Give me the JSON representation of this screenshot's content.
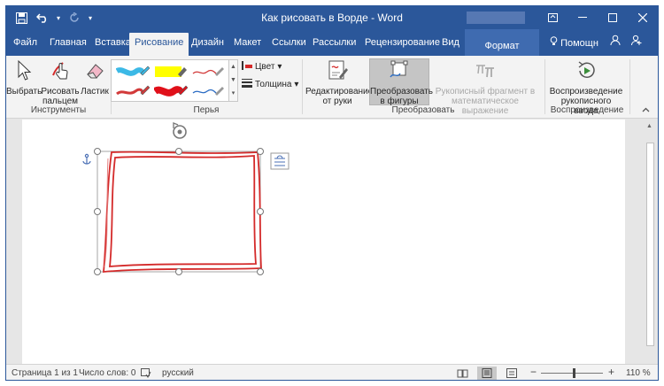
{
  "window": {
    "title": "Как рисовать в Ворде  -  Word",
    "controls": [
      "restore-ribbon",
      "minimize",
      "maximize",
      "close"
    ]
  },
  "quick_access": {
    "save_icon": "save-icon",
    "undo_icon": "undo-icon",
    "redo_icon": "redo-icon"
  },
  "tabs": [
    {
      "label": "Файл"
    },
    {
      "label": "Главная"
    },
    {
      "label": "Вставка"
    },
    {
      "label": "Рисование",
      "active": true
    },
    {
      "label": "Дизайн"
    },
    {
      "label": "Макет"
    },
    {
      "label": "Ссылки"
    },
    {
      "label": "Рассылки"
    },
    {
      "label": "Рецензирование"
    },
    {
      "label": "Вид"
    },
    {
      "label": "Формат",
      "contextual": true
    }
  ],
  "help": {
    "label": "Помощн"
  },
  "ribbon": {
    "tools": {
      "group_label": "Инструменты",
      "select_label": "Выбрать",
      "finger_label_1": "Рисовать",
      "finger_label_2": "пальцем",
      "eraser_label": "Ластик"
    },
    "pens": {
      "group_label": "Перья",
      "color_label": "Цвет",
      "thickness_label": "Толщина",
      "items": [
        {
          "type": "marker",
          "color": "#3cb9e6"
        },
        {
          "type": "highlighter",
          "color": "#ffff00"
        },
        {
          "type": "pen",
          "color": "#d23a3a"
        },
        {
          "type": "pen",
          "color": "#d23a3a"
        },
        {
          "type": "marker",
          "color": "#e0101a"
        },
        {
          "type": "pen",
          "color": "#2b6cc4"
        }
      ]
    },
    "convert": {
      "group_label": "Преобразовать",
      "edit_label_1": "Редактирование",
      "edit_label_2": "от руки",
      "shapes_label_1": "Преобразовать",
      "shapes_label_2": "в фигуры",
      "math_label_1": "Рукописный фрагмент в",
      "math_label_2": "математическое выражение"
    },
    "playback": {
      "group_label": "Воспроизведение",
      "replay_label_1": "Воспроизведение",
      "replay_label_2": "рукописного ввода"
    }
  },
  "status": {
    "page": "Страница 1 из 1",
    "words": "Число слов: 0",
    "language": "русский",
    "zoom": "110 %",
    "zoom_minus": "−",
    "zoom_plus": "+"
  },
  "colors": {
    "brand": "#2b579a",
    "ink": "#d42a2a"
  }
}
